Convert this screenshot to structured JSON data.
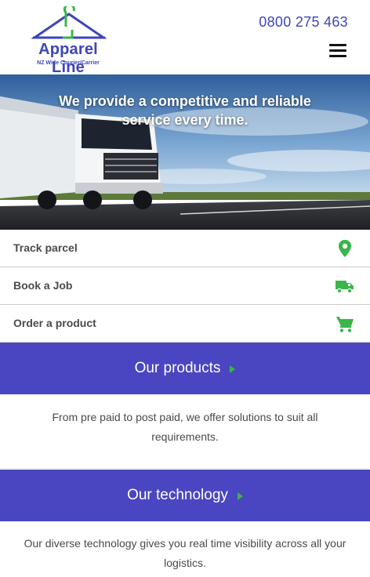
{
  "header": {
    "logo_name": "Apparel Line",
    "logo_tagline": "NZ Wide Courier/Carrier",
    "phone": "0800 275 463",
    "menu_icon": "hamburger-menu-icon"
  },
  "hero": {
    "headline": "We provide a competitive and reliable service every time."
  },
  "actions": [
    {
      "label": "Track parcel",
      "icon": "map-pin-icon"
    },
    {
      "label": "Book a Job",
      "icon": "truck-icon"
    },
    {
      "label": "Order a product",
      "icon": "shopping-cart-icon"
    }
  ],
  "sections": [
    {
      "title": "Our products",
      "text": "From pre paid to post paid, we offer solutions to suit all requirements."
    },
    {
      "title": "Our technology",
      "text": "Our diverse technology gives you real time visibility across all your logistics."
    }
  ],
  "colors": {
    "brand_blue": "#3f45b8",
    "band_purple": "#4a46c2",
    "accent_green": "#39b54a"
  }
}
